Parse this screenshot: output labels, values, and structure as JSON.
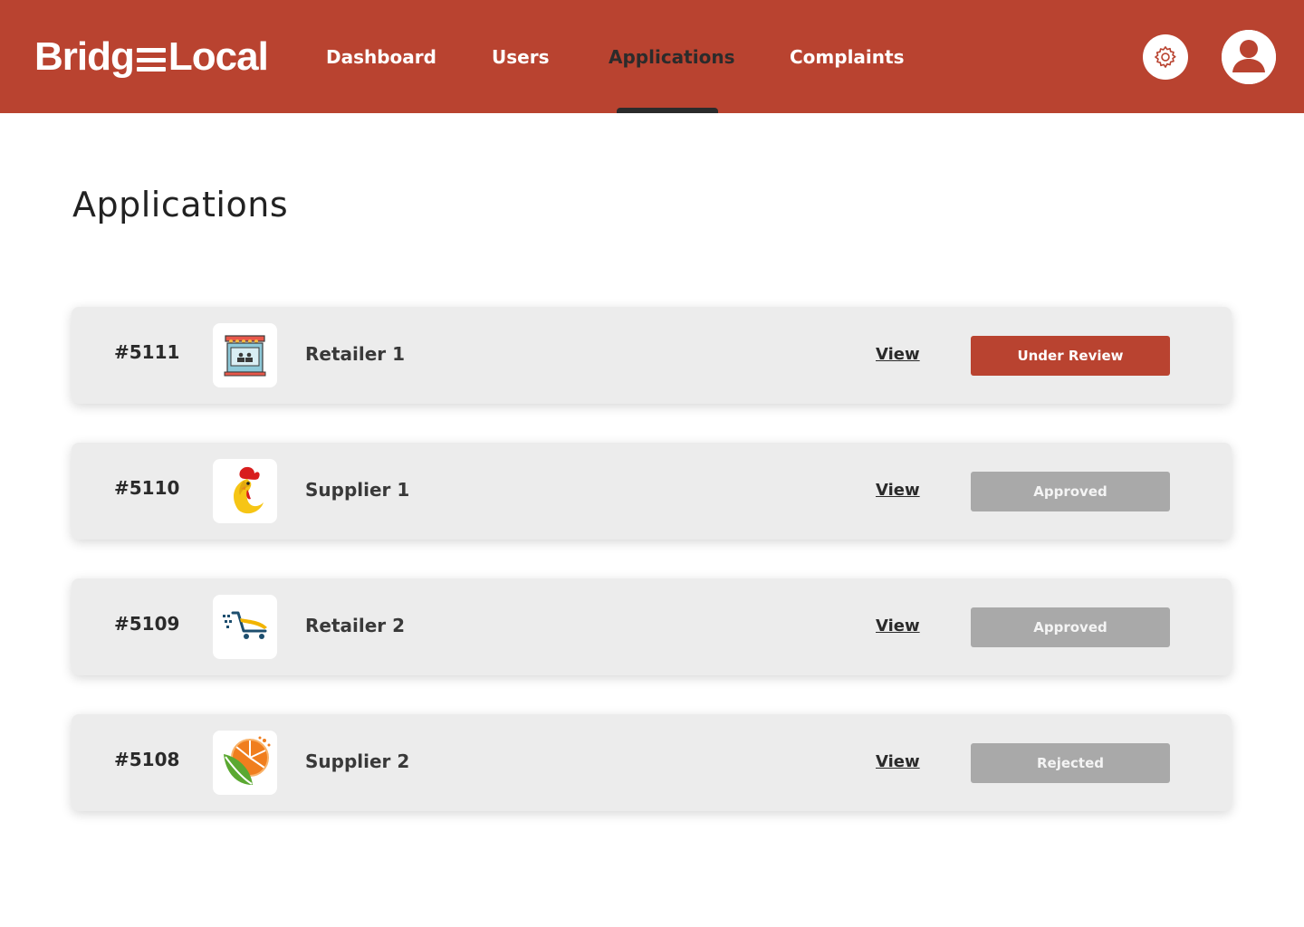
{
  "brand": {
    "left": "Bridg",
    "right": "Local"
  },
  "nav": {
    "items": [
      {
        "label": "Dashboard"
      },
      {
        "label": "Users"
      },
      {
        "label": "Applications",
        "active": true
      },
      {
        "label": "Complaints"
      }
    ]
  },
  "header_icons": {
    "settings": "gear-icon",
    "profile": "user-avatar-icon"
  },
  "page": {
    "title": "Applications"
  },
  "applications": [
    {
      "id": "#5111",
      "name": "Retailer 1",
      "logo": "storefront-logo",
      "view_label": "View",
      "status": "Under Review"
    },
    {
      "id": "#5110",
      "name": "Supplier 1",
      "logo": "rooster-logo",
      "view_label": "View",
      "status": "Approved"
    },
    {
      "id": "#5109",
      "name": "Retailer 2",
      "logo": "shopping-cart-logo",
      "view_label": "View",
      "status": "Approved"
    },
    {
      "id": "#5108",
      "name": "Supplier 2",
      "logo": "orange-leaf-logo",
      "view_label": "View",
      "status": "Rejected"
    }
  ],
  "colors": {
    "brand_red": "#b94330",
    "card_bg": "#ececec",
    "status_muted": "#a9a9a9",
    "text_dark": "#2b2b2b"
  }
}
